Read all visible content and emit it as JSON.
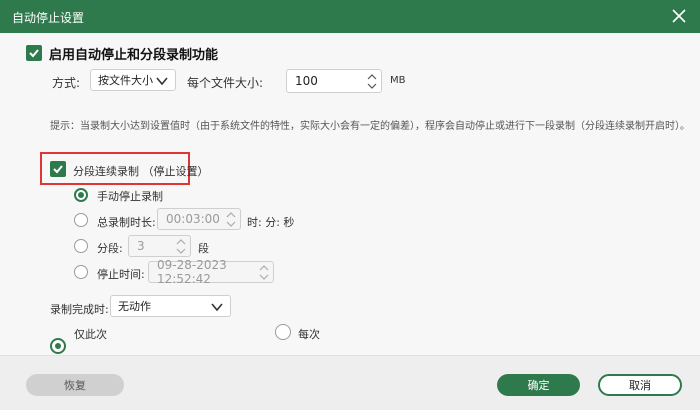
{
  "window": {
    "title": "自动停止设置"
  },
  "main": {
    "enable_label": "启用自动停止和分段录制功能",
    "mode_label": "方式:",
    "mode_value": "按文件大小",
    "size_label": "每个文件大小:",
    "size_value": "100",
    "size_unit": "MB",
    "hint": "提示：当录制大小达到设置值时（由于系统文件的特性，实际大小会有一定的偏差），程序会自动停止或进行下一段录制（分段连续录制开启时）。",
    "segment_label": "分段连续录制  （停止设置）",
    "options": {
      "manual": "手动停止录制",
      "duration_label": "总录制时长:",
      "duration_value": "00:03:00",
      "duration_units": "时: 分: 秒",
      "segments_label": "分段:",
      "segments_value": "3",
      "segments_unit": "段",
      "stop_time_label": "停止时间:",
      "stop_time_value": "09-28-2023 12:52:42"
    },
    "on_complete_label": "录制完成时:",
    "on_complete_value": "无动作",
    "once_label": "仅此次",
    "every_label": "每次"
  },
  "footer": {
    "reset": "恢复",
    "ok": "确定",
    "cancel": "取消"
  },
  "colors": {
    "accent": "#2f7a4d",
    "highlight_border": "#e03535"
  }
}
